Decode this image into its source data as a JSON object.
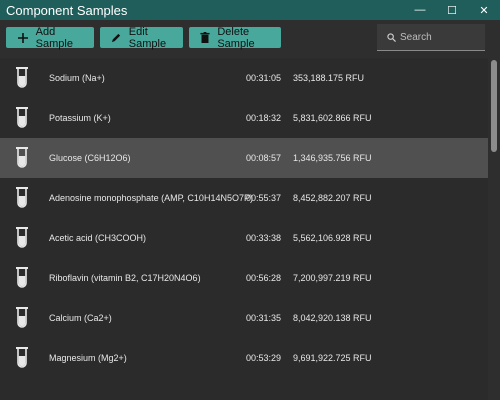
{
  "window": {
    "title": "Component Samples",
    "minimize_glyph": "—",
    "maximize_glyph": "☐",
    "close_glyph": "✕"
  },
  "toolbar": {
    "add_label": "Add Sample",
    "edit_label": "Edit Sample",
    "delete_label": "Delete Sample"
  },
  "search": {
    "placeholder": "Search",
    "value": ""
  },
  "colors": {
    "titlebar": "#1f5e5a",
    "accent": "#48a89b",
    "background": "#2b2b2b",
    "selected_row": "#505050"
  },
  "samples": [
    {
      "name": "Sodium (Na+)",
      "time": "00:31:05",
      "rfu": "353,188.175 RFU"
    },
    {
      "name": "Potassium (K+)",
      "time": "00:18:32",
      "rfu": "5,831,602.866 RFU"
    },
    {
      "name": "Glucose (C6H12O6)",
      "time": "00:08:57",
      "rfu": "1,346,935.756 RFU",
      "selected": true
    },
    {
      "name": "Adenosine monophosphate (AMP, C10H14N5O7P)",
      "time": "00:55:37",
      "rfu": "8,452,882.207 RFU"
    },
    {
      "name": "Acetic acid (CH3COOH)",
      "time": "00:33:38",
      "rfu": "5,562,106.928 RFU"
    },
    {
      "name": "Riboflavin (vitamin B2, C17H20N4O6)",
      "time": "00:56:28",
      "rfu": "7,200,997.219 RFU"
    },
    {
      "name": "Calcium (Ca2+)",
      "time": "00:31:35",
      "rfu": "8,042,920.138 RFU"
    },
    {
      "name": "Magnesium (Mg2+)",
      "time": "00:53:29",
      "rfu": "9,691,922.725 RFU"
    }
  ]
}
